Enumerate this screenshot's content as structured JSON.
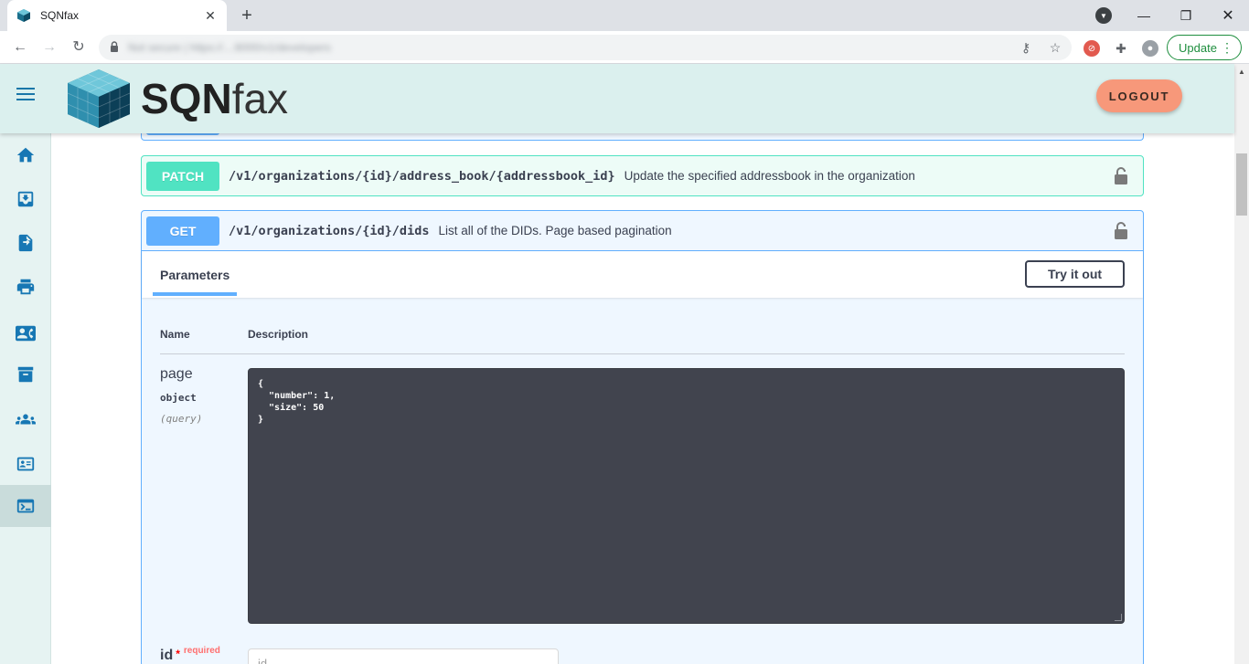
{
  "browser": {
    "tab_title": "SQNfax",
    "url_blurred": "Not secure  |  https://...:8000/v1/developers",
    "update_label": "Update"
  },
  "header": {
    "logo_bold": "SQN",
    "logo_light": "fax",
    "logout_label": "LOGOUT"
  },
  "sidebar": {
    "items": [
      {
        "icon": "home-icon"
      },
      {
        "icon": "inbox-icon"
      },
      {
        "icon": "send-document-icon"
      },
      {
        "icon": "printer-icon"
      },
      {
        "icon": "contacts-icon"
      },
      {
        "icon": "archive-icon"
      },
      {
        "icon": "users-icon"
      },
      {
        "icon": "id-card-icon"
      },
      {
        "icon": "terminal-icon"
      }
    ]
  },
  "operations": {
    "patch": {
      "method": "PATCH",
      "path": "/v1/organizations/{id}/address_book/{addressbook_id}",
      "description": "Update the specified addressbook in the organization"
    },
    "get": {
      "method": "GET",
      "path": "/v1/organizations/{id}/dids",
      "description": "List all of the DIDs. Page based pagination",
      "parameters_tab": "Parameters",
      "try_it_out": "Try it out",
      "col_name": "Name",
      "col_description": "Description",
      "params": [
        {
          "name": "page",
          "type": "object",
          "in": "(query)",
          "value": "{\n  \"number\": 1,\n  \"size\": 50\n}"
        },
        {
          "name": "id",
          "required_star": "*",
          "required_text": "required",
          "placeholder": "id"
        }
      ]
    }
  },
  "colors": {
    "patch": "#50e3c2",
    "get": "#61affe",
    "header_bg": "#dbf0ee",
    "logout": "#f7987a",
    "sidebar_icon": "#1777b4"
  }
}
